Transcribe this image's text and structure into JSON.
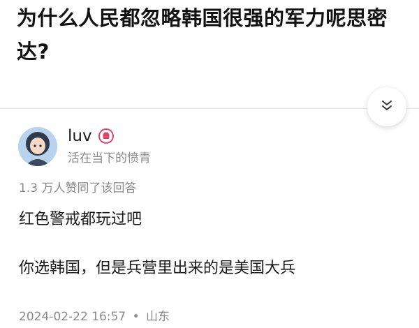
{
  "question": {
    "title": "为什么人民都忽略韩国很强的军力呢思密达?"
  },
  "controls": {
    "collapse_icon": "chevron-double-down-icon"
  },
  "answer": {
    "author": {
      "name": "luv",
      "bio": "活在当下的愤青",
      "badge_icon": "fist-badge-icon",
      "badge_color": "#e0446a"
    },
    "vote_text": "1.3 万人赞同了该回答",
    "content": [
      "红色警戒都玩过吧",
      "你选韩国，但是兵营里出来的是美国大兵"
    ],
    "date": "2024-02-22 16:57",
    "separator": "•",
    "location": "山东"
  }
}
